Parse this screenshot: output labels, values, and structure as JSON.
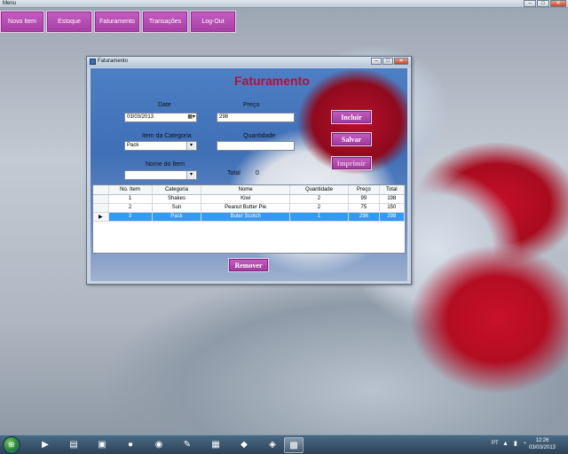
{
  "outer_window": {
    "title": "Menu",
    "controls": {
      "minimize": "–",
      "maximize": "□",
      "close": "✕"
    }
  },
  "menu": {
    "items": [
      {
        "label": "Novo Item"
      },
      {
        "label": "Estoque"
      },
      {
        "label": "Faturamento"
      },
      {
        "label": "Transações"
      },
      {
        "label": "Log-Out"
      }
    ]
  },
  "form": {
    "window_title": "Faturamento",
    "heading": "Faturamento",
    "date_label": "Date",
    "date_value": "03/03/2013",
    "categoria_label": "Item da Categoria",
    "categoria_value": "Pack",
    "nome_label": "Nome do Item",
    "nome_value": "",
    "preco_label": "Preço",
    "preco_value": "298",
    "quantidade_label": "Quantidade",
    "quantidade_value": "",
    "total_label": "Total",
    "total_value": "0",
    "buttons": {
      "incluir": "Incluir",
      "salvar": "Salvar",
      "imprimir": "Imprimir",
      "remover": "Remover"
    }
  },
  "grid": {
    "columns": [
      "No. Item",
      "Categoria",
      "Nome",
      "Quantidade",
      "Preço",
      "Total"
    ],
    "rows": [
      [
        "1",
        "Shakes",
        "Kiwi",
        "2",
        "99",
        "198"
      ],
      [
        "2",
        "Sun",
        "Peanut Butter Pie",
        "2",
        "75",
        "150"
      ],
      [
        "3",
        "Pack",
        "Buter Scotch",
        "1",
        "298",
        "298"
      ]
    ],
    "selected_row": 2,
    "row_marker": "▶"
  },
  "taskbar": {
    "language": "PT",
    "time": "12:26",
    "date": "03/03/2013"
  }
}
